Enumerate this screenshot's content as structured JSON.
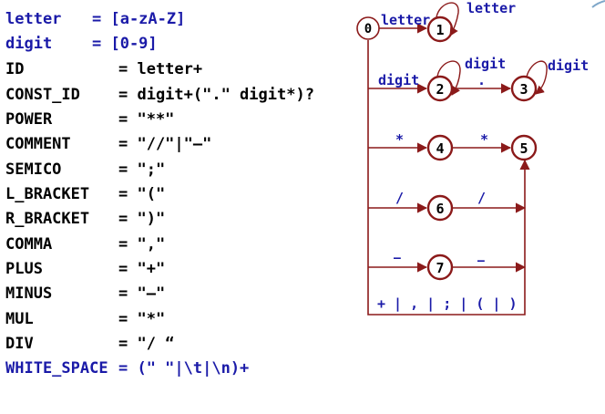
{
  "definitions": [
    {
      "name": "letter",
      "rule": "= [a-zA-Z]"
    },
    {
      "name": "digit",
      "rule": "= [0-9]"
    },
    {
      "name": "ID",
      "rule": "= letter+"
    },
    {
      "name": "CONST_ID",
      "rule": "= digit+(\".\" digit*)?"
    },
    {
      "name": "POWER",
      "rule": "= \"**\""
    },
    {
      "name": "COMMENT",
      "rule": "= \"//\"|\"—\""
    },
    {
      "name": "SEMICO",
      "rule": "= \";\""
    },
    {
      "name": "L_BRACKET",
      "rule": "= \"(\""
    },
    {
      "name": "R_BRACKET",
      "rule": "= \")\""
    },
    {
      "name": "COMMA",
      "rule": "= \",\""
    },
    {
      "name": "PLUS",
      "rule": "= \"+\""
    },
    {
      "name": "MINUS",
      "rule": "= \"—\""
    },
    {
      "name": "MUL",
      "rule": "= \"*\""
    },
    {
      "name": "DIV",
      "rule": "= \"/ “"
    },
    {
      "name": "WHITE_SPACE",
      "rule": "= (\" \"|\\t|\\n)+"
    }
  ],
  "dfa": {
    "states": [
      "0",
      "1",
      "2",
      "3",
      "4",
      "5",
      "6",
      "7"
    ],
    "labels": {
      "letter_in": "letter",
      "letter_loop": "letter",
      "digit_in": "digit",
      "digit_loop2": "digit",
      "dot": ".",
      "digit_loop3": "digit",
      "star1": "*",
      "star2": "*",
      "slash1": "/",
      "slash2": "/",
      "dash1": "—",
      "dash2": "—",
      "single_chars": "+ | , | ; | ( | )"
    },
    "colors": {
      "edge": "#8b1a1a",
      "state": "#8b1a1a",
      "label": "#1a1aa8"
    }
  }
}
